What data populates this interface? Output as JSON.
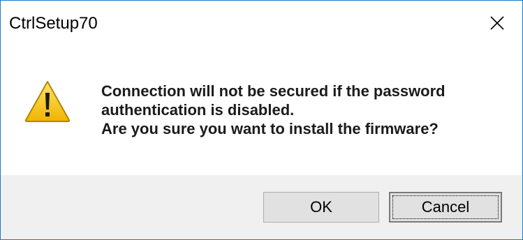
{
  "window": {
    "title": "CtrlSetup70"
  },
  "icons": {
    "close": "close-icon",
    "warning": "warning-icon"
  },
  "message": {
    "line1": "Connection will not be secured if the password",
    "line2": "authentication is disabled.",
    "line3": "Are you sure you want to install the firmware?"
  },
  "buttons": {
    "ok_label": "OK",
    "cancel_label": "Cancel"
  },
  "colors": {
    "window_border": "#1979ca",
    "warning_fill": "#f5c400",
    "footer_bg": "#f0f0f0"
  }
}
